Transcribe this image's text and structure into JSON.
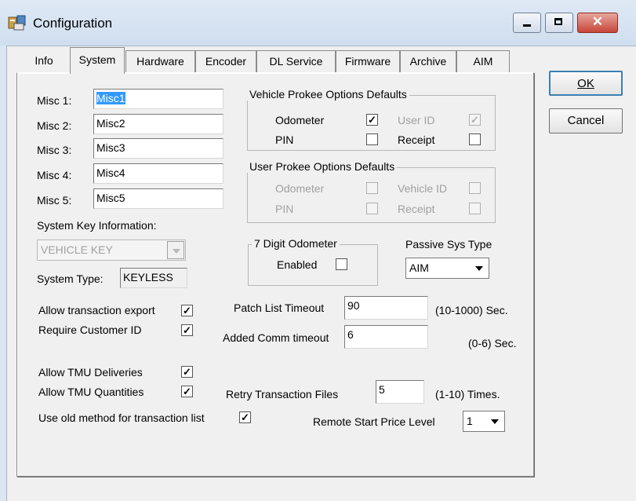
{
  "window": {
    "title": "Configuration"
  },
  "tabs": [
    "Info",
    "System",
    "Hardware",
    "Encoder",
    "DL Service",
    "Firmware",
    "Archive",
    "AIM"
  ],
  "selected_tab": "System",
  "buttons": {
    "ok": "OK",
    "cancel": "Cancel"
  },
  "misc": [
    {
      "label": "Misc 1:",
      "value": "Misc1"
    },
    {
      "label": "Misc 2:",
      "value": "Misc2"
    },
    {
      "label": "Misc 3:",
      "value": "Misc3"
    },
    {
      "label": "Misc 4:",
      "value": "Misc4"
    },
    {
      "label": "Misc 5:",
      "value": "Misc5"
    }
  ],
  "system_key": {
    "label": "System Key Information:",
    "value": "VEHICLE KEY"
  },
  "system_type": {
    "label": "System Type:",
    "value": "KEYLESS"
  },
  "vehicle_prokee": {
    "title": "Vehicle Prokee Options Defaults",
    "odometer": {
      "label": "Odometer",
      "checked": true
    },
    "user_id": {
      "label": "User ID",
      "checked": true
    },
    "pin": {
      "label": "PIN",
      "checked": false
    },
    "receipt": {
      "label": "Receipt",
      "checked": false
    }
  },
  "user_prokee": {
    "title": "User Prokee Options Defaults",
    "odometer": {
      "label": "Odometer",
      "checked": false
    },
    "vehicle_id": {
      "label": "Vehicle ID",
      "checked": false
    },
    "pin": {
      "label": "PIN",
      "checked": false
    },
    "receipt": {
      "label": "Receipt",
      "checked": false
    }
  },
  "seven_digit": {
    "title": "7 Digit Odometer",
    "enabled_label": "Enabled",
    "checked": false
  },
  "passive_sys": {
    "label": "Passive Sys Type",
    "value": "AIM"
  },
  "options": {
    "allow_export": {
      "label": "Allow transaction export",
      "checked": true
    },
    "require_customer": {
      "label": "Require Customer ID",
      "checked": true
    },
    "allow_tmu_deliveries": {
      "label": "Allow TMU Deliveries",
      "checked": true
    },
    "allow_tmu_quantities": {
      "label": "Allow TMU Quantities",
      "checked": true
    },
    "use_old_method": {
      "label": "Use old method for transaction list",
      "checked": true
    }
  },
  "patch_list": {
    "label": "Patch List Timeout",
    "value": "90",
    "range": "(10-1000) Sec."
  },
  "added_comm": {
    "label": "Added Comm timeout",
    "value": "6",
    "range": "(0-6) Sec."
  },
  "retry": {
    "label": "Retry Transaction Files",
    "value": "5",
    "range": "(1-10) Times."
  },
  "remote_start": {
    "label": "Remote Start Price Level",
    "value": "1"
  },
  "check_glyph": "✓"
}
